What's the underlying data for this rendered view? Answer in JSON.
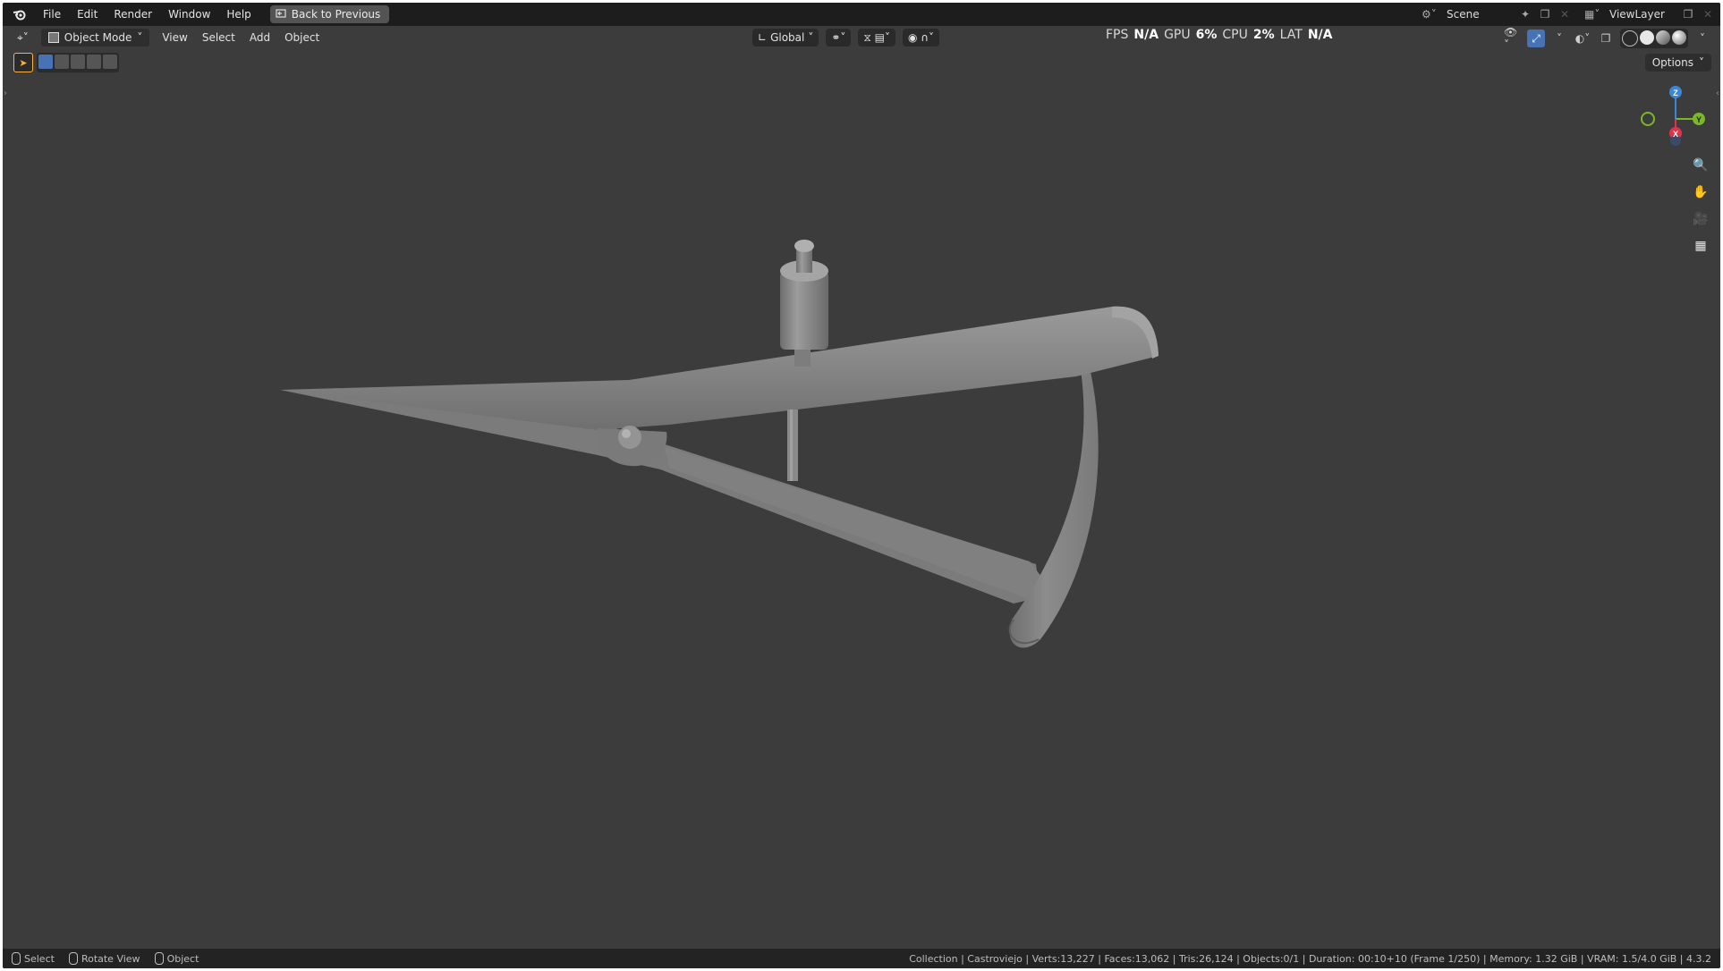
{
  "topbar": {
    "menu": [
      "File",
      "Edit",
      "Render",
      "Window",
      "Help"
    ],
    "back_button": "Back to Previous",
    "scene_label": "Scene",
    "viewlayer_label": "ViewLayer"
  },
  "viewport_header": {
    "mode": "Object Mode",
    "menu": [
      "View",
      "Select",
      "Add",
      "Object"
    ],
    "transform_orientation": "Global",
    "options_label": "Options"
  },
  "stats": {
    "fps_label": "FPS",
    "fps_value": "N/A",
    "gpu_label": "GPU",
    "gpu_value": "6%",
    "cpu_label": "CPU",
    "cpu_value": "2%",
    "lat_label": "LAT",
    "lat_value": "N/A"
  },
  "gizmo": {
    "z": "Z",
    "y": "Y",
    "x": "X"
  },
  "statusbar": {
    "left": [
      "Select",
      "Rotate View",
      "Object"
    ],
    "info": "Collection | Castroviejo | Verts:13,227 | Faces:13,062 | Tris:26,124 | Objects:0/1 | Duration: 00:10+10 (Frame 1/250) | Memory: 1.32 GiB | VRAM: 1.5/4.0 GiB | 4.3.2"
  },
  "colors": {
    "viewport_bg": "#3c3c3c",
    "topbar_bg": "#1d1d1d",
    "accent_blue": "#4772b3",
    "active_tool": "#ffb13b",
    "axis_x": "#e0334a",
    "axis_y": "#7ab828",
    "axis_z": "#3b86d6",
    "model_gray": "#858585"
  },
  "icons": [
    "blender-logo-icon",
    "back-icon",
    "scene-icon",
    "pin-icon",
    "viewlayer-icon",
    "editor-type-icon",
    "orientation-icon",
    "pivot-icon",
    "snap-icon",
    "proportional-icon",
    "visibility-icon",
    "gizmo-icon",
    "overlay-icon",
    "xray-icon",
    "zoom-icon",
    "hand-icon",
    "camera-icon",
    "grid-icon"
  ]
}
